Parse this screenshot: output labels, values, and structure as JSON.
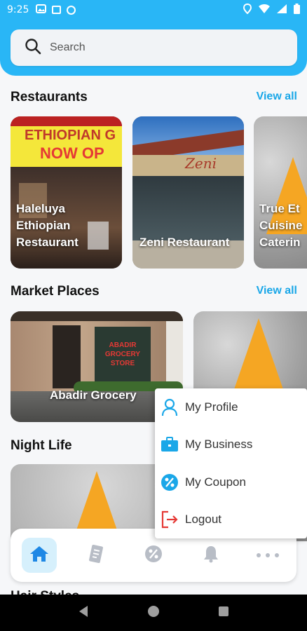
{
  "status_bar": {
    "time": "9:25"
  },
  "search": {
    "placeholder": "Search"
  },
  "sections": {
    "restaurants": {
      "title": "Restaurants",
      "view_all": "View all",
      "cards": [
        {
          "name": "Haleluya Ethiopian Restaurant",
          "sign_top": "ETHIOPIAN G",
          "sign_bottom": "NOW OP"
        },
        {
          "name": "Zeni Restaurant",
          "sign": "Zeni"
        },
        {
          "name": "True Et Cuisine Caterin"
        }
      ]
    },
    "market_places": {
      "title": "Market Places",
      "view_all": "View all",
      "cards": [
        {
          "name": "Abadir Grocery",
          "sign": "ABADIR GROCERY STORE"
        },
        {
          "name": ""
        }
      ]
    },
    "night_life": {
      "title": "Night Life"
    },
    "next_section_partial": "Hair Styles"
  },
  "popup_menu": {
    "items": [
      {
        "label": "My Profile",
        "icon": "person-icon"
      },
      {
        "label": "My Business",
        "icon": "briefcase-icon"
      },
      {
        "label": "My Coupon",
        "icon": "percent-icon"
      },
      {
        "label": "Logout",
        "icon": "logout-icon"
      }
    ]
  },
  "bottom_nav": [
    "home-icon",
    "receipt-icon",
    "percent-icon",
    "bell-icon",
    "more-icon"
  ],
  "colors": {
    "accent": "#29b6f6",
    "link": "#1aa7e8",
    "active_nav_bg": "#d6f0fc",
    "logout": "#e53935"
  }
}
